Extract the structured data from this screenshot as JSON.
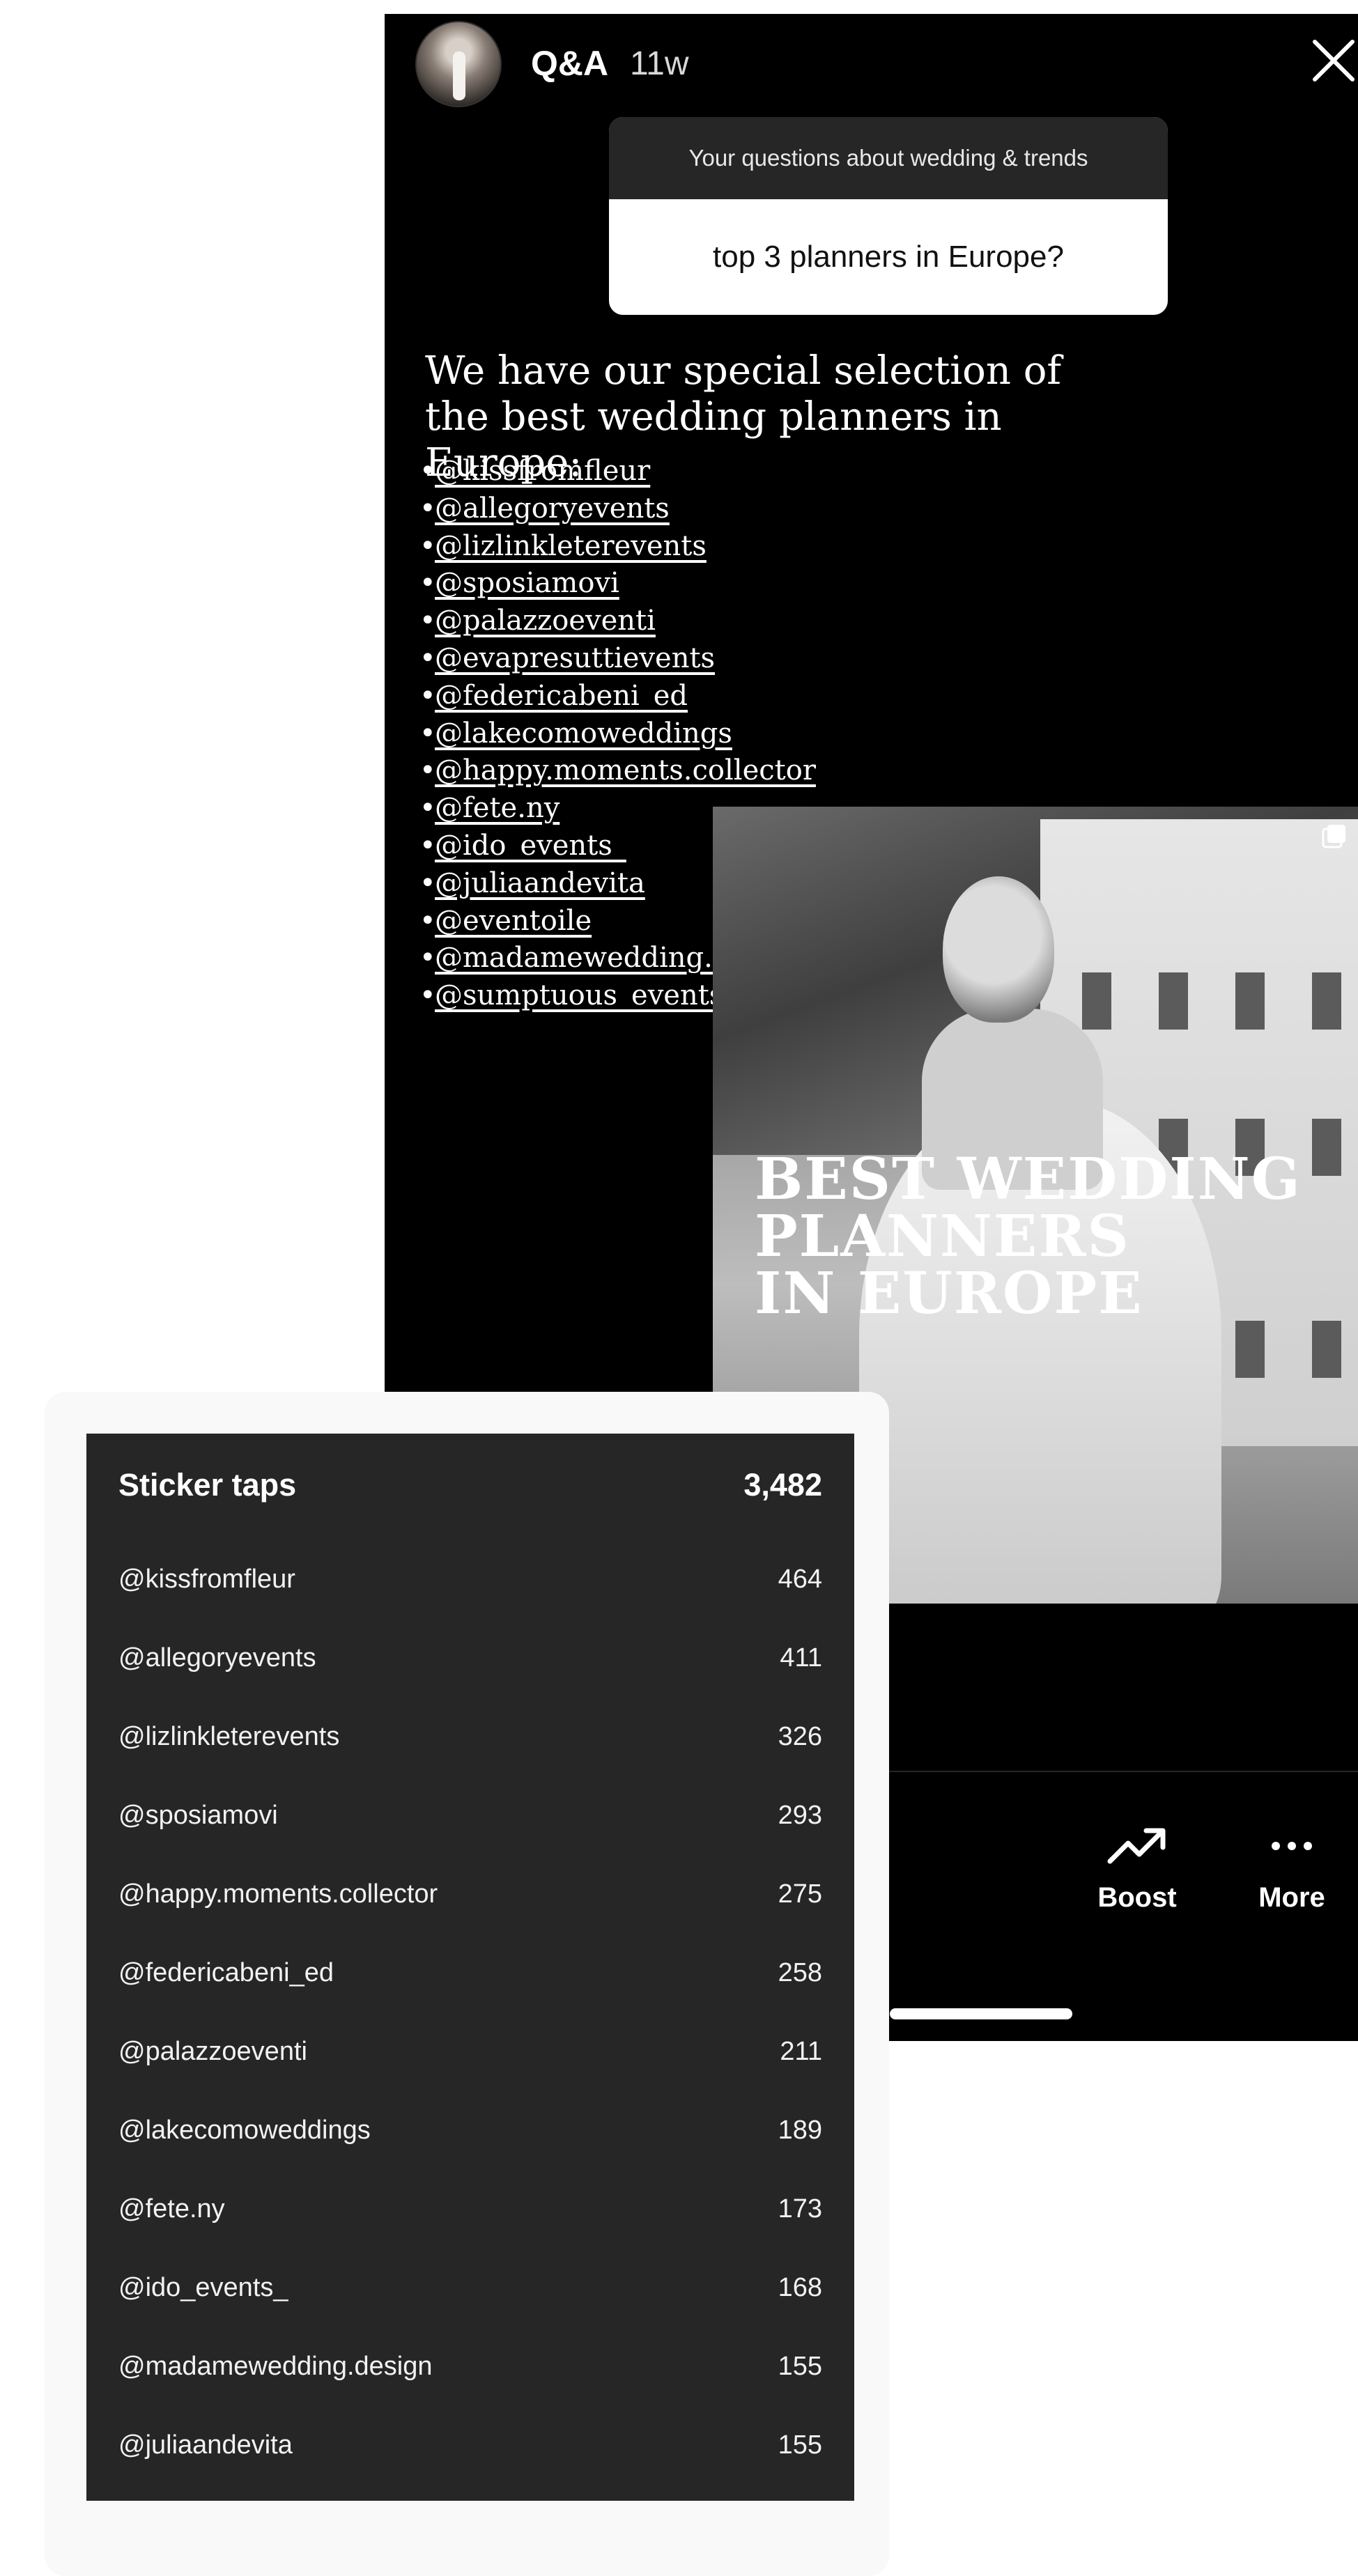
{
  "story": {
    "title": "Q&A",
    "age": "11w",
    "question_card": {
      "header": "Your questions about wedding & trends",
      "question": "top 3 planners in Europe?"
    },
    "answer_intro": "We have our special selection of the best wedding planners in Europe:",
    "handles": [
      "@kissfromfleur",
      "@allegoryevents",
      "@lizlinkleterevents",
      "@sposiamovi",
      "@palazzoeventi",
      "@evapresuttievents",
      "@federicabeni_ed",
      "@lakecomoweddings",
      "@happy.moments.collector",
      "@fete.ny",
      "@ido_events_",
      "@juliaandevita",
      "@eventoile",
      "@madamewedding.design",
      "@sumptuous_events_"
    ],
    "post_title": [
      "BEST WEDDING",
      "PLANNERS",
      "IN EUROPE"
    ],
    "actions": [
      {
        "label": "Boost",
        "icon": "trending-up-icon"
      },
      {
        "label": "More",
        "icon": "more-dots-icon"
      }
    ]
  },
  "sticker_taps": {
    "title": "Sticker taps",
    "total": "3,482",
    "rows": [
      {
        "handle": "@kissfromfleur",
        "count": "464"
      },
      {
        "handle": "@allegoryevents",
        "count": "411"
      },
      {
        "handle": "@lizlinkleterevents",
        "count": "326"
      },
      {
        "handle": "@sposiamovi",
        "count": "293"
      },
      {
        "handle": "@happy.moments.collector",
        "count": "275"
      },
      {
        "handle": "@federicabeni_ed",
        "count": "258"
      },
      {
        "handle": "@palazzoeventi",
        "count": "211"
      },
      {
        "handle": "@lakecomoweddings",
        "count": "189"
      },
      {
        "handle": "@fete.ny",
        "count": "173"
      },
      {
        "handle": "@ido_events_",
        "count": "168"
      },
      {
        "handle": "@madamewedding.design",
        "count": "155"
      },
      {
        "handle": "@juliaandevita",
        "count": "155"
      }
    ]
  },
  "colors": {
    "story_bg": "#000000",
    "panel_bg": "#f9f9f9",
    "taps_bg": "#262626",
    "text": "#ffffff"
  }
}
